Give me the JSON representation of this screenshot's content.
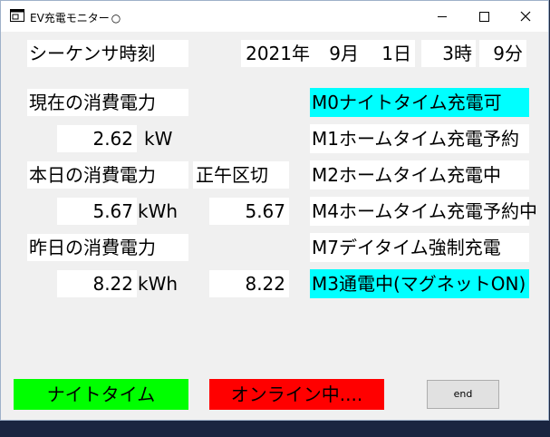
{
  "window": {
    "title": "EV充電モニター",
    "title_status_glyph": "○",
    "icon": "app-window-icon"
  },
  "sequencer": {
    "label": "シーケンサ時刻",
    "year": "2021年",
    "month": "9月",
    "day": "1日",
    "hour": "3時",
    "minute": "9分"
  },
  "current": {
    "label": "現在の消費電力",
    "value": "2.62",
    "unit": "kW"
  },
  "today": {
    "label": "本日の消費電力",
    "value": "5.67",
    "unit": "kWh",
    "noon_label": "正午区切",
    "noon_value": "5.67"
  },
  "yesterday": {
    "label": "昨日の消費電力",
    "value": "8.22",
    "unit": "kWh",
    "noon_value": "8.22"
  },
  "statuses": [
    {
      "text": "M0ナイトタイム充電可",
      "active": true
    },
    {
      "text": "M1ホームタイム充電予約",
      "active": false
    },
    {
      "text": "M2ホームタイム充電中",
      "active": false
    },
    {
      "text": "M4ホームタイム充電予約中",
      "active": false
    },
    {
      "text": "M7デイタイム強制充電",
      "active": false
    },
    {
      "text": "M3通電中(マグネットON)",
      "active": true
    }
  ],
  "indicators": {
    "time_mode": "ナイトタイム",
    "online": "オンライン中....",
    "time_mode_color": "#00ff00",
    "online_color": "#ff0000"
  },
  "colors": {
    "status_active": "#00ffff",
    "status_inactive": "#ffffff"
  },
  "end_button": "end"
}
